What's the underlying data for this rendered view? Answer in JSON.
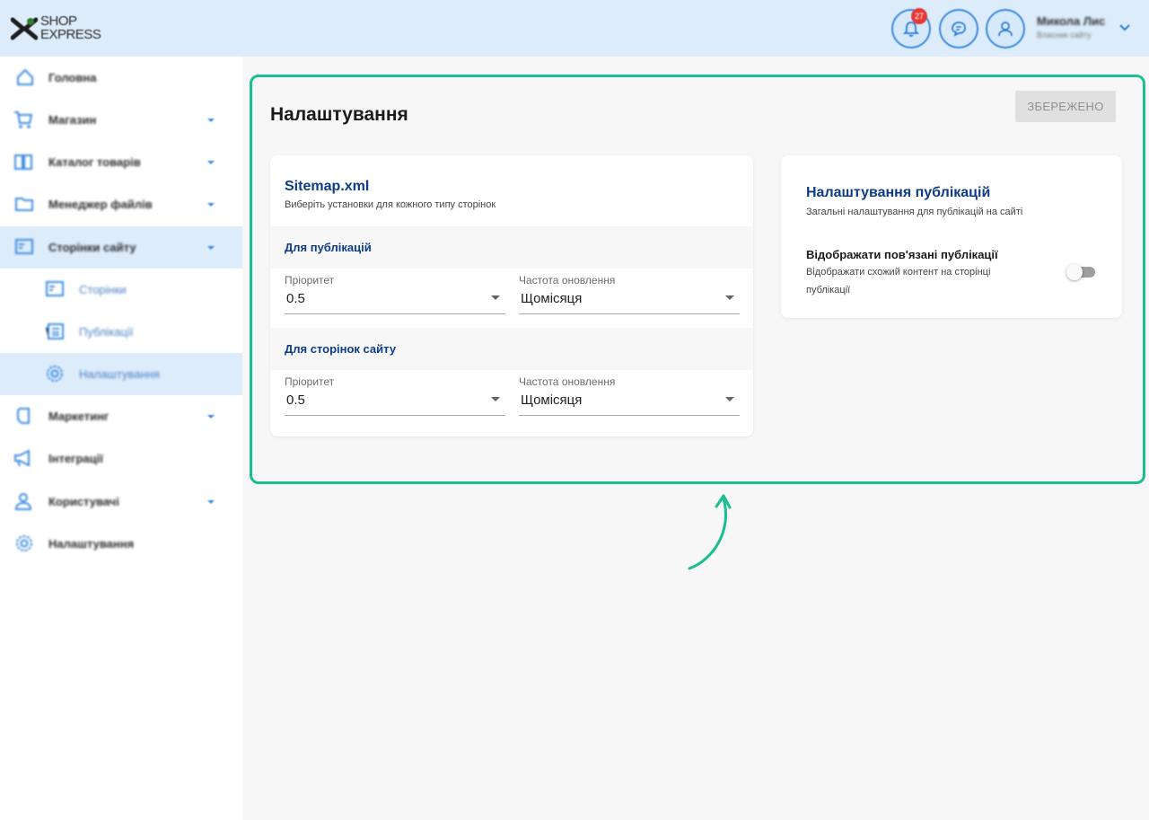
{
  "header": {
    "logo_text_line1": "SHOP",
    "logo_text_line2": "EXPRESS",
    "notifications_badge": "27",
    "user_name": "Микола Лис",
    "user_role": "Власник сайту",
    "accent_color": "#3d8be0"
  },
  "sidebar": {
    "items": [
      {
        "label": "Головна",
        "icon": "home-icon",
        "has_chevron": false
      },
      {
        "label": "Магазин",
        "icon": "cart-icon",
        "has_chevron": true
      },
      {
        "label": "Каталог товарів",
        "icon": "book-icon",
        "has_chevron": true
      },
      {
        "label": "Менеджер файлів",
        "icon": "folder-icon",
        "has_chevron": true
      },
      {
        "label": "Сторінки сайту",
        "icon": "pages-icon",
        "has_chevron": true,
        "active": true
      },
      {
        "label": "Сторінки",
        "icon": "page-icon",
        "sub": true
      },
      {
        "label": "Публікації",
        "icon": "newspaper-icon",
        "sub": true
      },
      {
        "label": "Налаштування",
        "icon": "gear-icon",
        "sub": true,
        "active": true
      },
      {
        "label": "Маркетинг",
        "icon": "marketing-icon",
        "has_chevron": true
      },
      {
        "label": "Інтеграції",
        "icon": "megaphone-icon",
        "has_chevron": false
      },
      {
        "label": "Користувачі",
        "icon": "user-icon",
        "has_chevron": true
      },
      {
        "label": "Налаштування",
        "icon": "gear-icon",
        "has_chevron": false
      }
    ]
  },
  "main": {
    "title": "Налаштування",
    "save_label": "ЗБЕРЕЖЕНО",
    "sitemap": {
      "title": "Sitemap.xml",
      "subtitle": "Виберіть установки для кожного типу сторінок",
      "sections": [
        {
          "title": "Для публікацій",
          "priority_label": "Пріоритет",
          "priority_value": "0.5",
          "frequency_label": "Частота оновлення",
          "frequency_value": "Щомісяця"
        },
        {
          "title": "Для сторінок сайту",
          "priority_label": "Пріоритет",
          "priority_value": "0.5",
          "frequency_label": "Частота оновлення",
          "frequency_value": "Щомісяця"
        }
      ]
    },
    "publications": {
      "title": "Налаштування публікацій",
      "subtitle": "Загальні налаштування для публікацій на сайті",
      "option_title": "Відображати пов'язані публікації",
      "option_desc_line1": "Відображати схожий контент на сторінці",
      "option_desc_line2": "публікації",
      "toggle_on": false
    },
    "highlight_color": "#1bbf8f"
  }
}
